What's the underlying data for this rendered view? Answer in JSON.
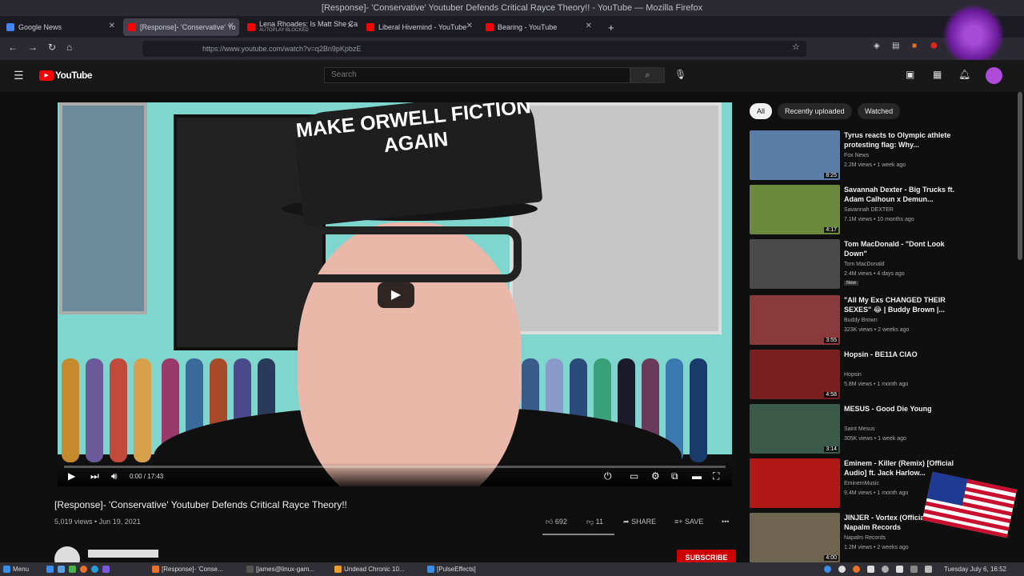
{
  "window": {
    "title": "[Response]- 'Conservative' Youtuber Defends Critical Rayce Theory!! - YouTube — Mozilla Firefox"
  },
  "tabs": [
    {
      "label": "Google News",
      "color": "#4285f4"
    },
    {
      "label": "[Response]- 'Conservative' Yo",
      "color": "#ff0000"
    },
    {
      "label": "Lena Rhoades: Is Matt She Ca",
      "sub": "AUTOPLAY BLOCKED",
      "color": "#ff0000"
    },
    {
      "label": "Liberal Hivemind - YouTube",
      "color": "#ff0000"
    },
    {
      "label": "Bearing - YouTube",
      "color": "#ff0000"
    }
  ],
  "new_tab": "+",
  "url": "https://www.youtube.com/watch?v=q2Bn9pKpbzE",
  "youtube": {
    "logo": "YouTube",
    "search_placeholder": "Search",
    "video": {
      "cap_text": "MAKE ORWELL FICTION AGAIN",
      "time": "0:00 / 17:43",
      "title": "[Response]- 'Conservative' Youtuber Defends Critical Rayce Theory!!",
      "meta": "5,019 views • Jun 19, 2021",
      "likes": "692",
      "dislikes": "11",
      "share": "SHARE",
      "save": "SAVE",
      "subscribe": "SUBSCRIBE"
    },
    "chips": [
      "All",
      "Recently uploaded",
      "Watched"
    ],
    "recommended": [
      {
        "title": "Tyrus reacts to Olympic athlete protesting flag: Why...",
        "channel": "Fox News",
        "meta": "2.2M views • 1 week ago",
        "duration": "8:25",
        "color": "#5a7ea8"
      },
      {
        "title": "Savannah Dexter - Big Trucks ft. Adam Calhoun x Demun...",
        "channel": "Savannah DEXTER",
        "meta": "7.1M views • 10 months ago",
        "duration": "4:17",
        "color": "#6b8a3e"
      },
      {
        "title": "Tom MacDonald - \"Dont Look Down\"",
        "channel": "Tom MacDonald",
        "meta": "2.4M views • 4 days ago",
        "duration": "",
        "badge": "New",
        "color": "#4a4a4a"
      },
      {
        "title": "\"All My Exs CHANGED THEIR SEXES\" 😂 | Buddy Brown |...",
        "channel": "Buddy Brown",
        "meta": "323K views • 2 weeks ago",
        "duration": "3:55",
        "color": "#8a3a3a"
      },
      {
        "title": "Hopsin - BE11A CIAO",
        "channel": "Hopsin",
        "meta": "5.8M views • 1 month ago",
        "duration": "4:58",
        "color": "#7a1f1f"
      },
      {
        "title": "MESUS - Good Die Young",
        "channel": "Saint Mesus",
        "meta": "305K views • 1 week ago",
        "duration": "3:14",
        "color": "#3c5a4a"
      },
      {
        "title": "Eminem - Killer (Remix) [Official Audio] ft. Jack Harlow...",
        "channel": "EminemMusic",
        "meta": "9.4M views • 1 month ago",
        "duration": "",
        "color": "#b01818"
      },
      {
        "title": "JINJER - Vortex (Official Video) | Napalm Records",
        "channel": "Napalm Records",
        "meta": "1.2M views • 2 weeks ago",
        "duration": "4:00",
        "color": "#6e6450"
      }
    ]
  },
  "taskbar": {
    "menu": "Menu",
    "items": [
      {
        "label": "[Response]- 'Conse...",
        "color": "#e8702a"
      },
      {
        "label": "[james@linux-gam...",
        "color": "#555"
      },
      {
        "label": "Undead Chronic 10...",
        "color": "#e8a02a"
      },
      {
        "label": "[PulseEffects]",
        "color": "#3a8ee6"
      }
    ],
    "clock": "Tuesday July 6, 16:52"
  }
}
